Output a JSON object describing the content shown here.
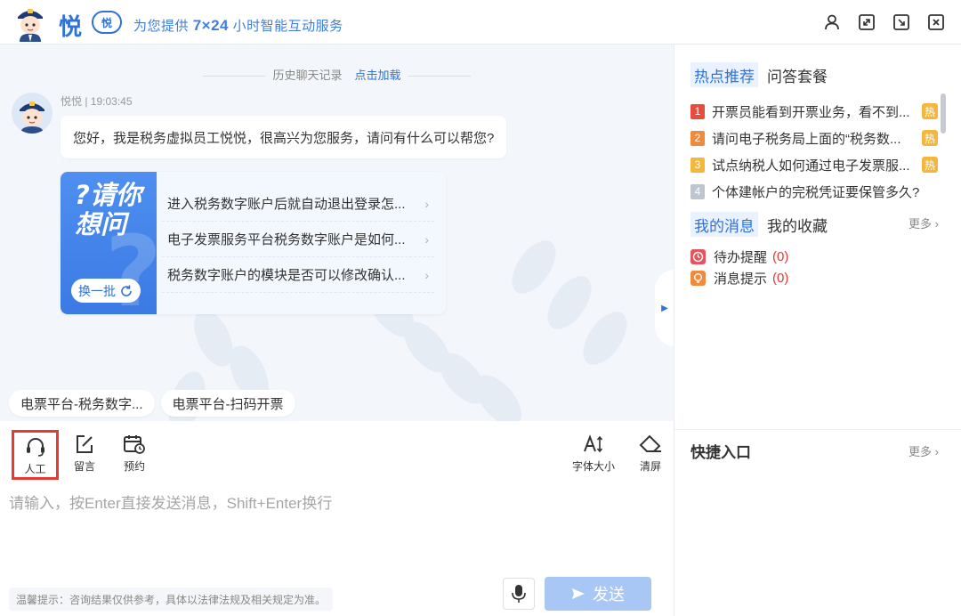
{
  "header": {
    "brand_char": "悦",
    "brand_badge": "悦",
    "tagline_prefix": "为您提供",
    "tagline_highlight": "7×24",
    "tagline_suffix": "小时智能互动服务"
  },
  "chat": {
    "history_label": "历史聊天记录",
    "history_link": "点击加载",
    "bot_meta": "悦悦 | 19:03:45",
    "greeting": "您好，我是税务虚拟员工悦悦，很高兴为您服务，请问有什么可以帮您?",
    "ask_card": {
      "title_line1": "?请你",
      "title_line2": "想问",
      "refresh_label": "换一批",
      "items": [
        "进入税务数字账户后就自动退出登录怎...",
        "电子发票服务平台税务数字账户是如何...",
        "税务数字账户的模块是否可以修改确认..."
      ]
    },
    "chips": [
      "电票平台-税务数字...",
      "电票平台-扫码开票"
    ]
  },
  "toolbar": {
    "human_label": "人工",
    "message_label": "留言",
    "appointment_label": "预约",
    "font_size_label": "字体大小",
    "clear_label": "清屏"
  },
  "input": {
    "placeholder": "请输入，按Enter直接发送消息，Shift+Enter换行",
    "notice": "温馨提示：咨询结果仅供参考，具体以法律法规及相关规定为准。",
    "send_label": "发送"
  },
  "right_panel": {
    "tabs": [
      "热点推荐",
      "问答套餐"
    ],
    "hot_items": [
      {
        "rank": "1",
        "text": "开票员能看到开票业务，看不到...",
        "tag": "热",
        "color": "#e84c3d"
      },
      {
        "rank": "2",
        "text": "请问电子税务局上面的“税务数...",
        "tag": "热",
        "color": "#f08a3c"
      },
      {
        "rank": "3",
        "text": "试点纳税人如何通过电子发票服...",
        "tag": "热",
        "color": "#f3b73e"
      },
      {
        "rank": "4",
        "text": "个体建帐户的完税凭证要保管多久?",
        "tag": "",
        "color": "#bfc5ce"
      }
    ],
    "msg_tabs": [
      "我的消息",
      "我的收藏"
    ],
    "more_label": "更多",
    "messages": [
      {
        "label": "待办提醒",
        "count": "(0)",
        "icon": "clock-icon",
        "color": "#e5545c"
      },
      {
        "label": "消息提示",
        "count": "(0)",
        "icon": "bulb-icon",
        "color": "#f08a3c"
      }
    ],
    "quick_title": "快捷入口",
    "quick_more": "更多"
  },
  "colors": {
    "accent": "#2f72d8",
    "highlight_border": "#e53935",
    "send_disabled": "#a9c7f5"
  }
}
